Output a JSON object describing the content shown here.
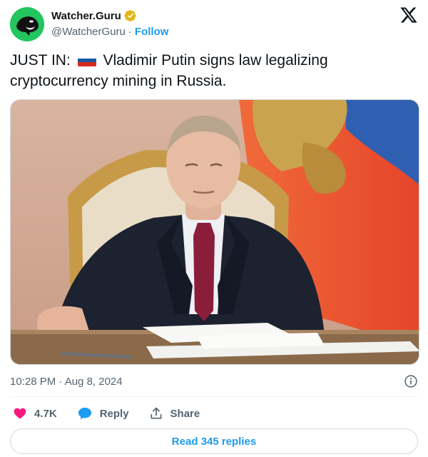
{
  "author": {
    "display_name": "Watcher.Guru",
    "handle": "@WatcherGuru",
    "separator": "·",
    "follow_label": "Follow",
    "avatar_icon": "orca-logo",
    "avatar_color": "#22c55e",
    "verified_color": "#e2b719"
  },
  "tweet": {
    "prefix": "JUST IN:",
    "flag_icon": "russia-flag",
    "body": "Vladimir Putin signs law legalizing cryptocurrency mining in Russia."
  },
  "meta": {
    "timestamp": "10:28 PM · Aug 8, 2024"
  },
  "actions": {
    "likes_count": "4.7K",
    "reply_label": "Reply",
    "share_label": "Share",
    "like_color": "#f91880",
    "reply_color": "#1d9bf0"
  },
  "footer": {
    "read_replies_label": "Read 345 replies"
  },
  "colors": {
    "accent": "#1d9bf0",
    "secondary_text": "#536471",
    "primary_text": "#0f1419"
  }
}
